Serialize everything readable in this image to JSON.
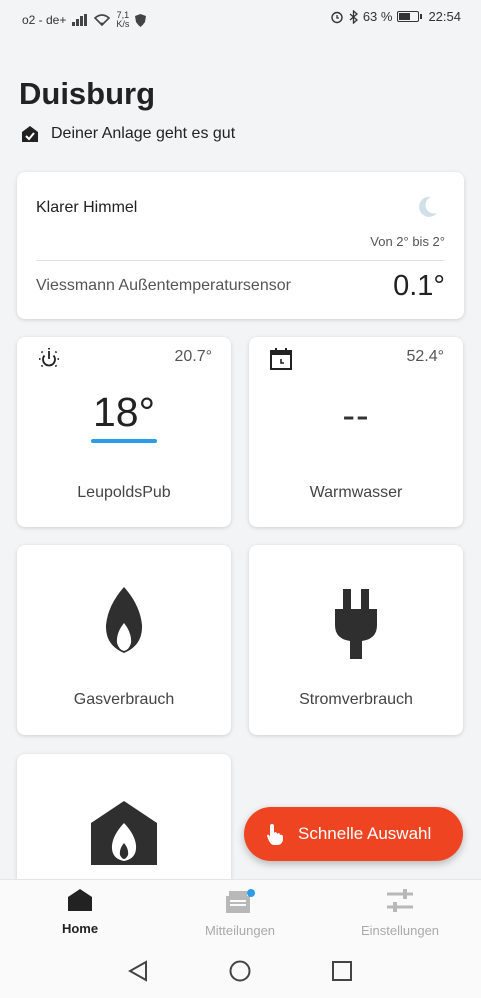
{
  "status_bar": {
    "carrier": "o2 - de+",
    "net_speed_value": "7,1",
    "net_speed_unit": "K/s",
    "battery_percent": "63 %",
    "battery_level": 0.63,
    "time": "22:54"
  },
  "header": {
    "title": "Duisburg",
    "status": "Deiner Anlage geht es gut"
  },
  "weather": {
    "condition": "Klarer Himmel",
    "icon": "moon-icon",
    "range": "Von 2° bis 2°",
    "sensor_label": "Viessmann Außentemperatursensor",
    "sensor_value": "0.1°"
  },
  "tiles": {
    "heating": {
      "name": "LeupoldsPub",
      "setpoint": "18°",
      "current": "20.7°",
      "icon": "sun-mode-icon"
    },
    "hot_water": {
      "name": "Warmwasser",
      "setpoint": "--",
      "current": "52.4°",
      "icon": "schedule-icon"
    },
    "gas": {
      "name": "Gasverbrauch",
      "icon": "flame-icon"
    },
    "power": {
      "name": "Stromverbrauch",
      "icon": "plug-icon"
    },
    "heating_system": {
      "icon": "house-flame-icon"
    }
  },
  "fab": {
    "label": "Schnelle Auswahl",
    "icon": "hand-pointer-icon"
  },
  "bottom_nav": {
    "items": [
      {
        "label": "Home",
        "icon": "home-icon",
        "active": true
      },
      {
        "label": "Mitteilungen",
        "icon": "inbox-icon",
        "active": false
      },
      {
        "label": "Einstellungen",
        "icon": "sliders-icon",
        "active": false
      }
    ]
  },
  "colors": {
    "accent_fab": "#ee4422",
    "setpoint_bar": "#2b9de8",
    "notification_dot": "#2b9de8"
  }
}
